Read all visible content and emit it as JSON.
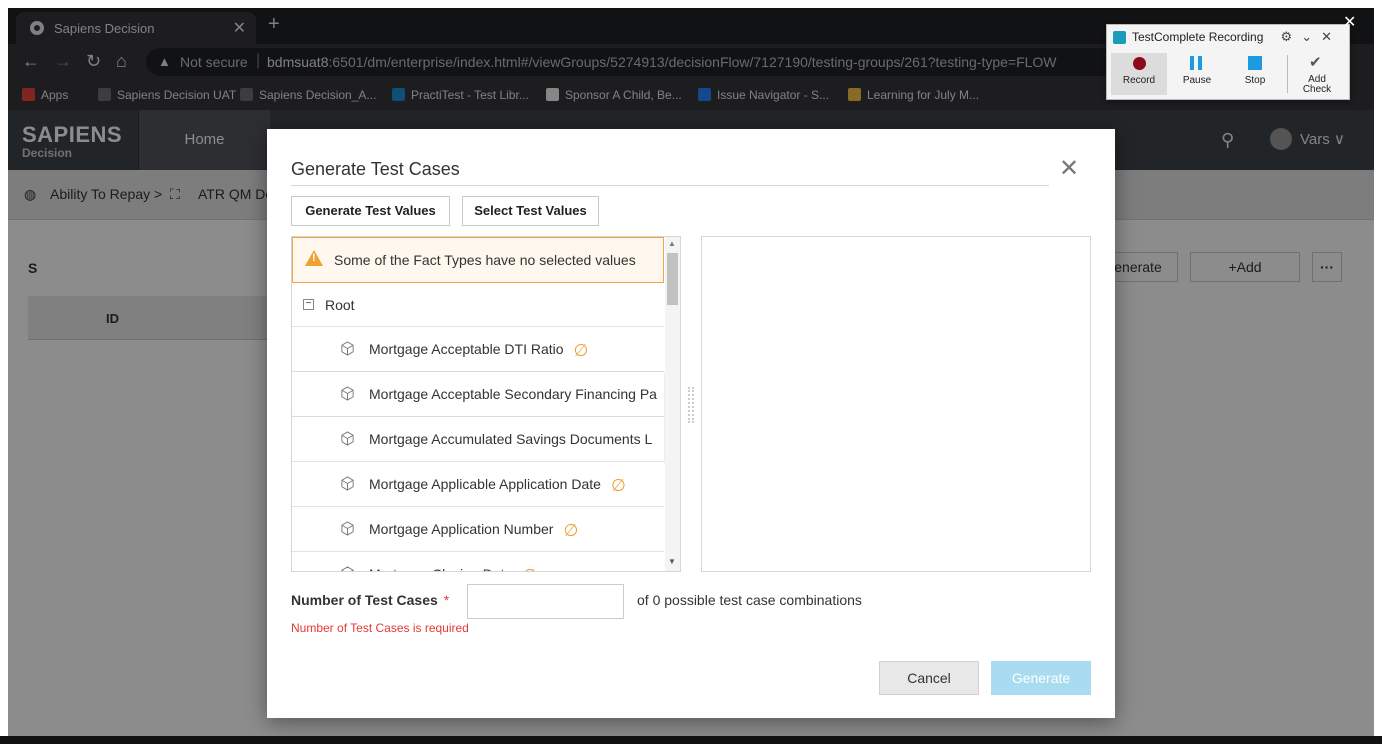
{
  "browser": {
    "tab_title": "Sapiens Decision",
    "not_secure": "Not secure",
    "url_host": "bdmsuat8",
    "url_rest": ":6501/dm/enterprise/index.html#/viewGroups/5274913/decisionFlow/7127190/testing-groups/261?testing-type=FLOW",
    "bookmarks": [
      "Apps",
      "Sapiens Decision UAT",
      "Sapiens Decision_A...",
      "PractiTest - Test Libr...",
      "Sponsor A Child, Be...",
      "Issue Navigator - S...",
      "Learning for July M..."
    ],
    "bookmark_colors": [
      "#e8453c",
      "#6c6f73",
      "#6c6f73",
      "#1f8fd6",
      "#f5f5f5",
      "#2684ff",
      "#f6c343"
    ]
  },
  "app": {
    "logo_main": "SAPIENS",
    "logo_sub": "Decision",
    "nav_home": "Home",
    "user_name": "Vars ∨",
    "breadcrumb_1": "Ability To Repay >",
    "breadcrumb_2": "ATR QM De",
    "section_label": "S",
    "table_header_id": "ID",
    "btn_generate": "enerate",
    "btn_add": "+Add",
    "btn_more": "···"
  },
  "modal": {
    "title": "Generate Test Cases",
    "close_symbol": "✕",
    "btn_generate_values": "Generate Test Values",
    "btn_select_values": "Select Test Values",
    "warning": "Some of the Fact Types have no selected values",
    "root_label": "Root",
    "fact_types": [
      {
        "label": "Mortgage Acceptable DTI Ratio",
        "no_value": true
      },
      {
        "label": "Mortgage Acceptable Secondary Financing Pa",
        "no_value": false
      },
      {
        "label": "Mortgage Accumulated Savings Documents L",
        "no_value": false
      },
      {
        "label": "Mortgage Applicable Application Date",
        "no_value": true
      },
      {
        "label": "Mortgage Application Number",
        "no_value": true
      },
      {
        "label": "Mortgage Closing Date",
        "no_value": true
      }
    ],
    "null_symbol": "∅",
    "number_label": "Number of Test Cases",
    "required_mark": "*",
    "number_value": "",
    "possible_text": "of 0 possible test case combinations",
    "error_text": "Number of Test Cases is required",
    "cancel_label": "Cancel",
    "generate_label": "Generate",
    "accent_color": "#f0a030",
    "error_color": "#e53935",
    "primary_disabled_color": "#a9dcf0"
  },
  "testcomplete": {
    "title": "TestComplete Recording",
    "record": "Record",
    "pause": "Pause",
    "stop": "Stop",
    "add_check_1": "Add",
    "add_check_2": "Check"
  }
}
